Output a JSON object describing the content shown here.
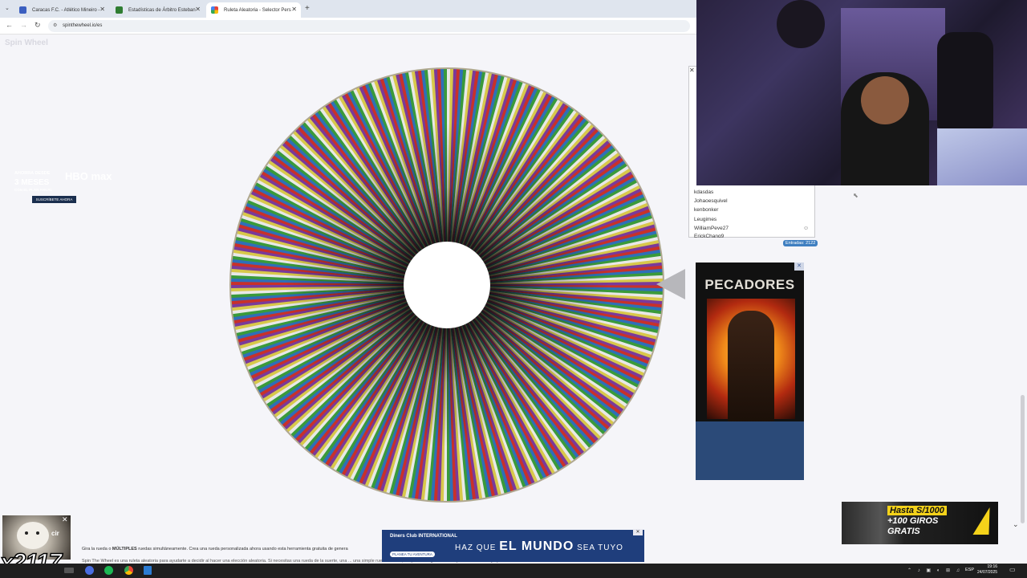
{
  "browser": {
    "tabs": [
      {
        "title": "Caracas F.C. - Atlético Mineiro -",
        "icon_color": "#3b5fc0"
      },
      {
        "title": "Estadísticas de Árbitro Esteban",
        "icon_color": "#2f7d32"
      },
      {
        "title": "Ruleta Aleatoria - Selector Pers",
        "icon_color": "#4285f4",
        "active": true
      }
    ],
    "new_tab": "+",
    "url": "spinthewheel.io/es"
  },
  "site": {
    "logo": "Spin Wheel"
  },
  "wheel": {
    "segments": 2122,
    "colors": [
      "#c8312a",
      "#2f6fb8",
      "#3a9a3a",
      "#e8e8e8",
      "#d8c84a",
      "#7a3a9a"
    ]
  },
  "entries": {
    "close": "✕",
    "visible": [
      "kdasdas",
      "Johaoesquivel",
      "kenbonker",
      "Leugimes",
      "WilliamPeve27",
      "ErickChang9"
    ],
    "count_label": "Entradas: 2122"
  },
  "ad": {
    "title": "PECADORES",
    "line1": "AHORRA DESDE",
    "big": "3 MESES",
    "line2": "CON EL PLAN ANUAL",
    "brand": "HBO max",
    "cta": "SUSCRÍBETE AHORA",
    "close": "✕"
  },
  "diners": {
    "logo": "Diners Club INTERNATIONAL",
    "tag": "PLANEA TU AVENTURA",
    "slogan_pre": "HAZ QUE",
    "slogan_bold": "EL MUNDO",
    "slogan_post": "SEA TUYO",
    "close": "✕"
  },
  "casino": {
    "line1": "Hasta S/1000",
    "line2": "+100 GIROS",
    "line3": "GRATIS"
  },
  "page_text": {
    "p1_pre": "Gira la rueda o ",
    "p1_bold": "MÚLTIPLES",
    "p1_post": " ruedas simultáneamente. Crea una rueda personalizada ahora usando esta herramienta gratuita de genera",
    "p2": "Spin The Wheel es una ruleta aleatoria para ayudarte a decidir al hacer una elección aleatoria. Si necesitas una rueda de la suerte, una ... una simple rueda si lo es, simplemente gira la rueda para obtener la tuya personalizada."
  },
  "overlay": {
    "cat_label": "cir",
    "multiplier": "x2117"
  },
  "taskbar": {
    "lang": "ESP",
    "time": "19:16",
    "date": "24/07/2025"
  }
}
